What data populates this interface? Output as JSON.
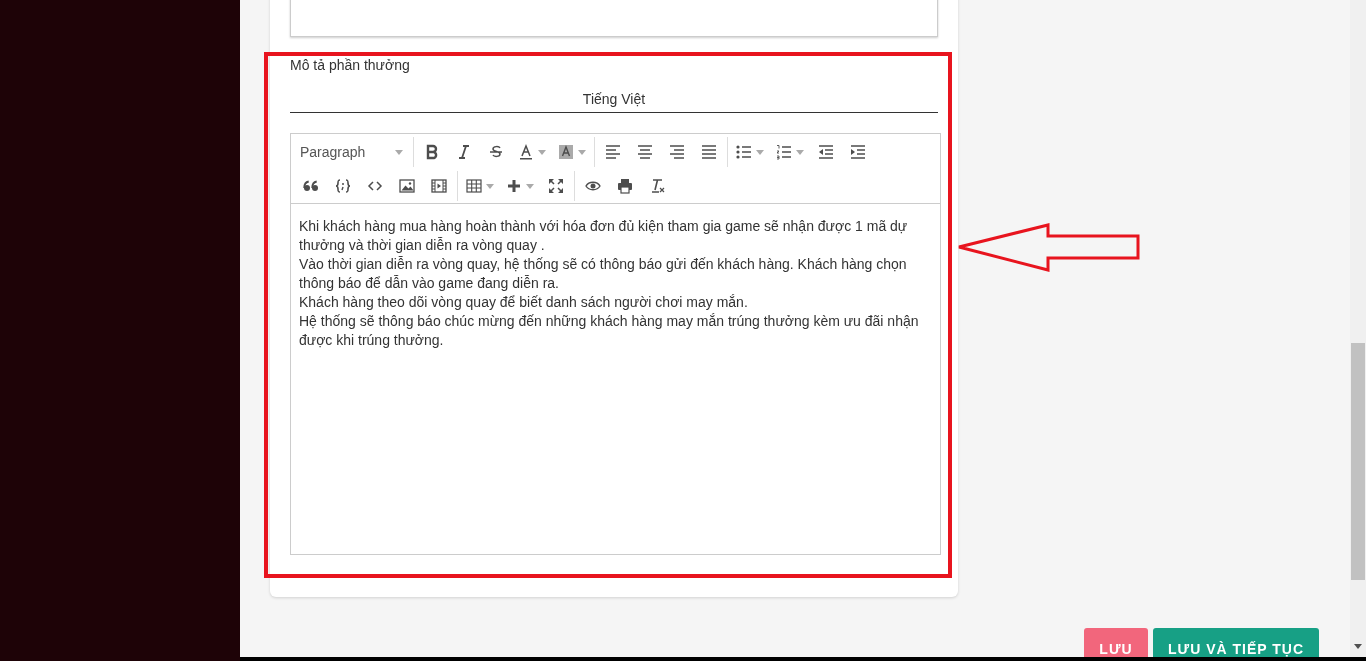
{
  "field_label": "Mô tả phần thưởng",
  "language_tabs": [
    {
      "label": "Tiếng Việt",
      "selected": true
    }
  ],
  "editor": {
    "format_select": "Paragraph",
    "paragraphs": [
      "Khi khách hàng mua hàng hoàn thành với hóa đơn đủ kiện tham gia game sẽ nhận được 1 mã dự thưởng và thời gian diễn ra vòng quay .",
      "Vào thời gian diễn ra vòng quay, hệ thống sẽ có thông báo gửi đến khách hàng. Khách hàng chọn thông báo để dẫn vào game đang diễn ra.",
      "Khách hàng theo dõi vòng quay để biết danh sách người chơi may mắn.",
      "Hệ thống sẽ thông báo chúc mừng đến những khách hàng may mắn trúng thưởng kèm ưu đãi nhận được khi trúng thưởng."
    ]
  },
  "buttons": [
    {
      "label": "LƯU",
      "kind": "save"
    },
    {
      "label": "LƯU VÀ TIẾP TỤC",
      "kind": "save_continue"
    }
  ]
}
